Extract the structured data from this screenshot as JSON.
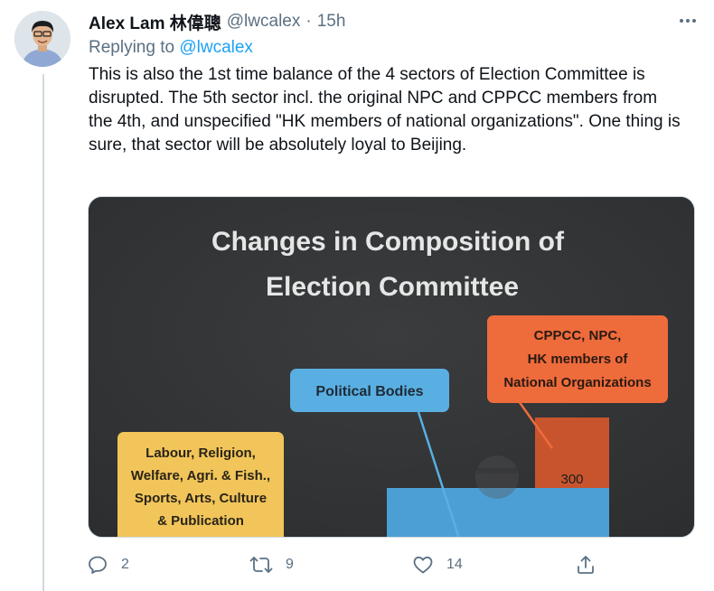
{
  "tweet": {
    "author_name": "Alex Lam 林偉聰",
    "author_handle": "@lwcalex",
    "separator": "·",
    "time": "15h",
    "replying_prefix": "Replying to",
    "replying_to": "@lwcalex",
    "text": "This is also the 1st time balance of the 4 sectors of Election Committee is disrupted. The 5th sector incl. the original NPC and CPPCC members from the 4th, and unspecified \"HK members of national organizations\". One thing is sure, that sector will be absolutely loyal to Beijing.",
    "more_icon": "more-dots-icon"
  },
  "media": {
    "title_line1": "Changes in Composition of",
    "title_line2": "Election Committee",
    "label_political": "Political Bodies",
    "label_labour_lines": [
      "Labour, Religion,",
      "Welfare, Agri. & Fish.,",
      "Sports, Arts, Culture",
      "& Publication"
    ],
    "label_cppcc_lines": [
      "CPPCC, NPC,",
      "HK members of",
      "National Organizations"
    ],
    "bar_value": "300",
    "colors": {
      "background": "#333537",
      "political": "#59afe1",
      "labour": "#f1c55a",
      "cppcc": "#ee6b3b",
      "bar_orange": "#c8542e"
    }
  },
  "actions": {
    "reply_count": "2",
    "retweet_count": "9",
    "like_count": "14",
    "reply_icon": "reply-icon",
    "retweet_icon": "retweet-icon",
    "like_icon": "heart-icon",
    "share_icon": "share-icon"
  }
}
